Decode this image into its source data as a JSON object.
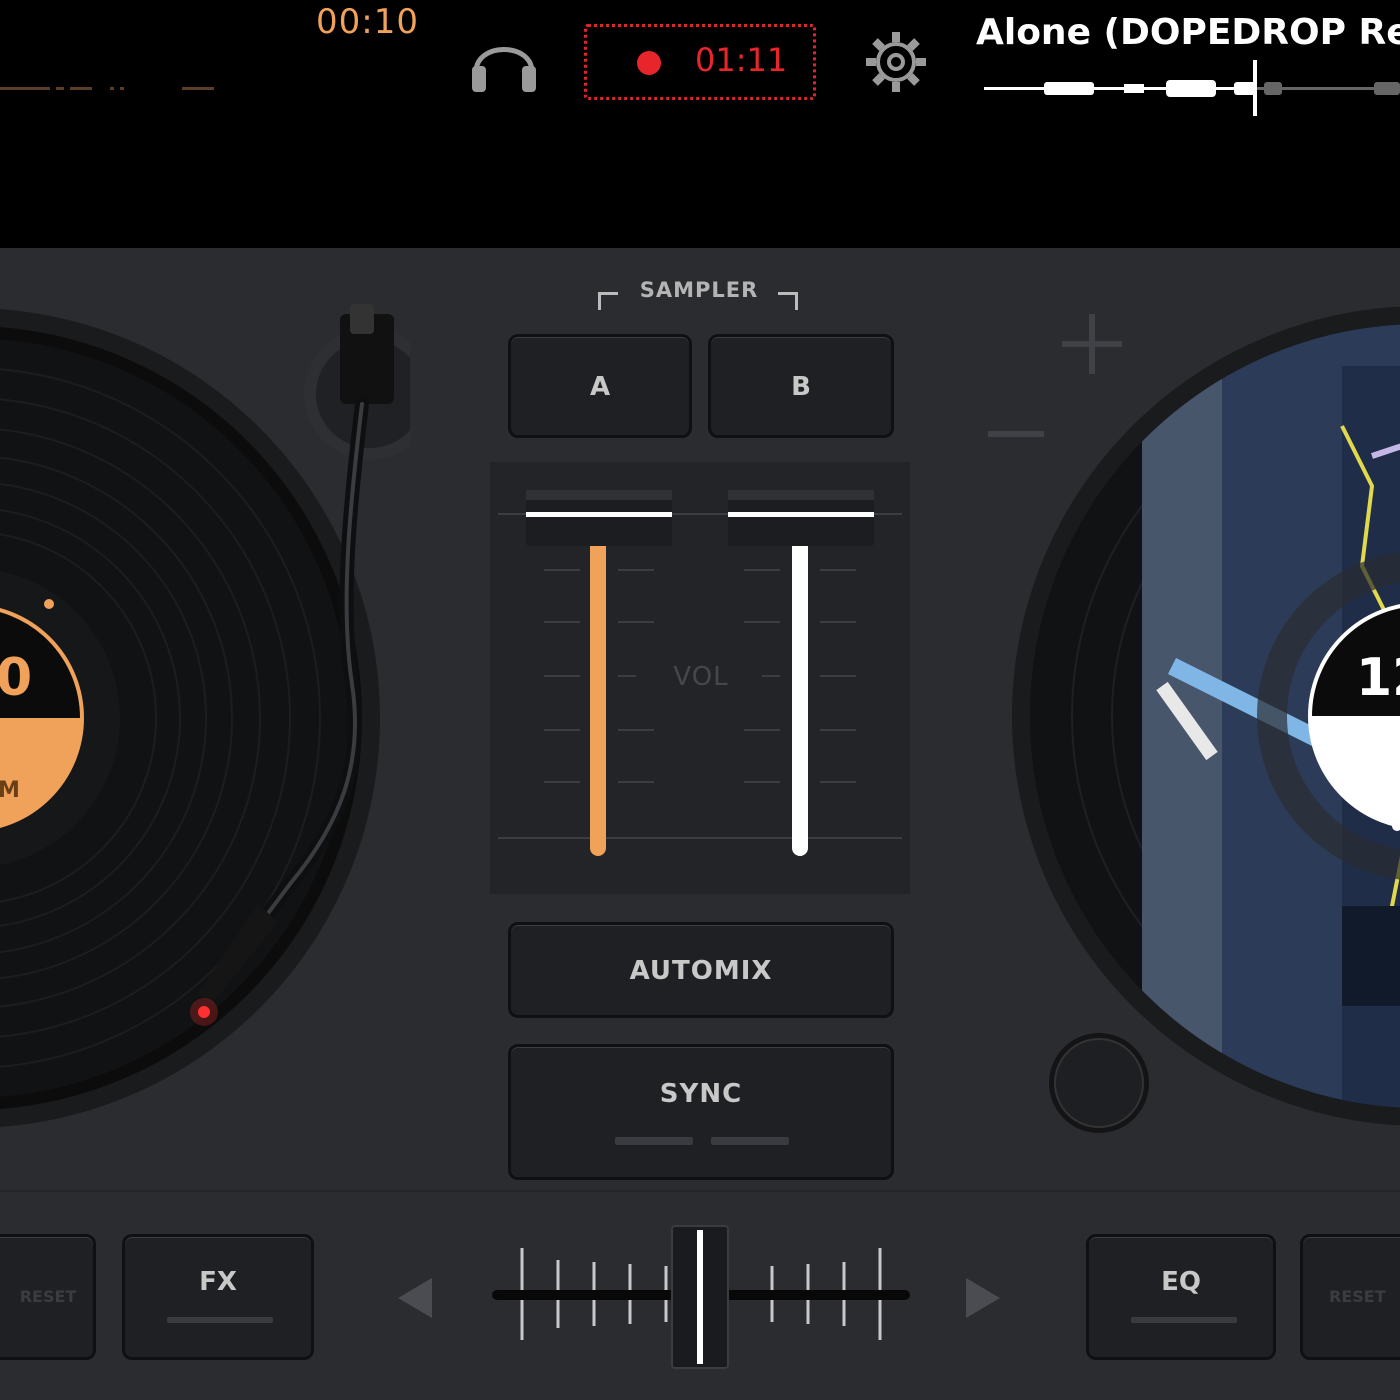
{
  "top_bar": {
    "elapsed_time": "00:10",
    "record_time": "01:11",
    "track_title": "Alone (DOPEDROP Re"
  },
  "left_deck": {
    "bpm_fragment": "0",
    "bpm_unit_fragment": "M"
  },
  "right_deck": {
    "bpm_fragment": "12"
  },
  "center": {
    "sampler_label": "SAMPLER",
    "pad_a_label": "A",
    "pad_b_label": "B",
    "volume_label": "VOL",
    "automix_label": "AUTOMIX",
    "sync_label": "SYNC"
  },
  "bottom_bar": {
    "reset_left_label": "RESET",
    "fx_label": "FX",
    "eq_label": "EQ",
    "reset_right_label": "RESET"
  },
  "colors": {
    "deck_a_accent": "#f0a15a",
    "deck_b_accent": "#ffffff",
    "record_red": "#e8252b",
    "panel_bg": "#2a2c30"
  },
  "icons": [
    "headphones-icon",
    "record-dot-icon",
    "gear-icon",
    "plus-icon",
    "minus-icon",
    "arrow-left-icon",
    "arrow-right-icon"
  ]
}
